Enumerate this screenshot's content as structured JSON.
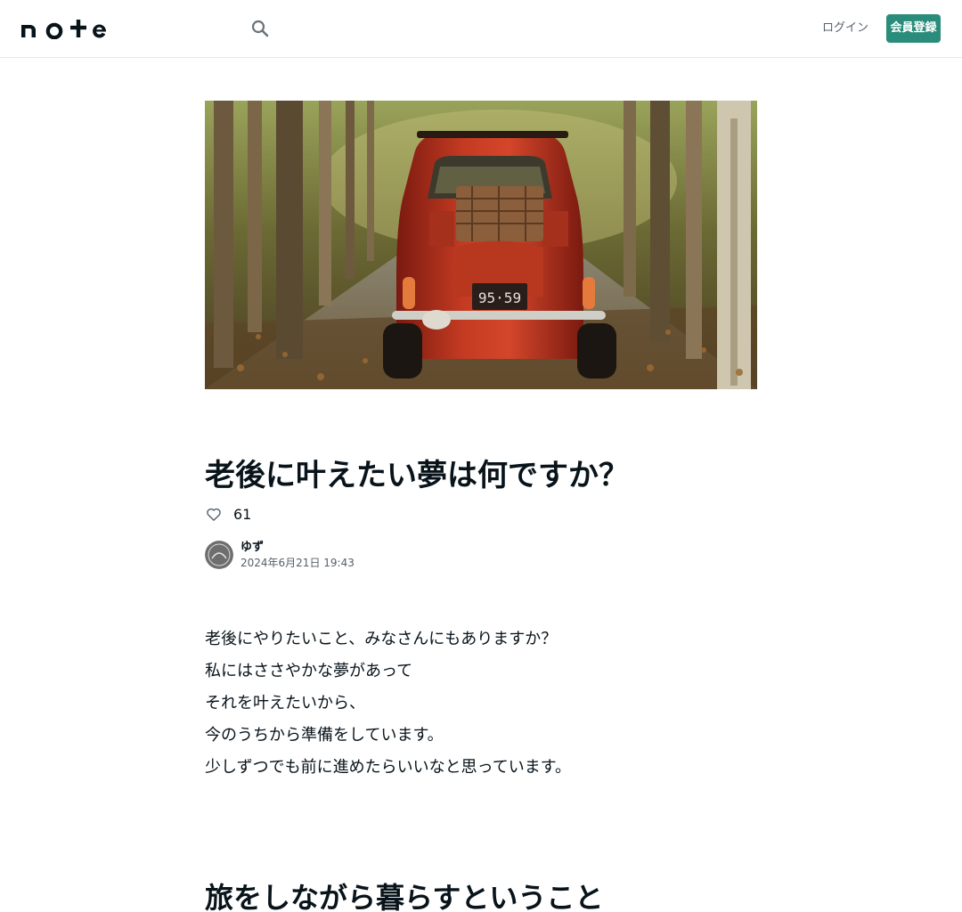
{
  "header": {
    "logo_text": "note",
    "search_icon": "search-icon",
    "login_label": "ログイン",
    "signup_label": "会員登録",
    "accent_color": "#2a8c7a"
  },
  "article": {
    "hero_image": "red-vintage-car-on-leafy-road",
    "title": "老後に叶えたい夢は何ですか？",
    "likes": "61",
    "like_icon": "heart-outline-icon",
    "author": {
      "name": "ゆず",
      "date": "2024年6月21日 19:43",
      "avatar": "avatar-image"
    },
    "body_lines": [
      "老後にやりたいこと、みなさんにもありますか？",
      "私にはささやかな夢があって",
      "それを叶えたいから、",
      "今のうちから準備をしています。",
      "少しずつでも前に進めたらいいなと思っています。"
    ],
    "section_heading": "旅をしながら暮らすということ"
  }
}
